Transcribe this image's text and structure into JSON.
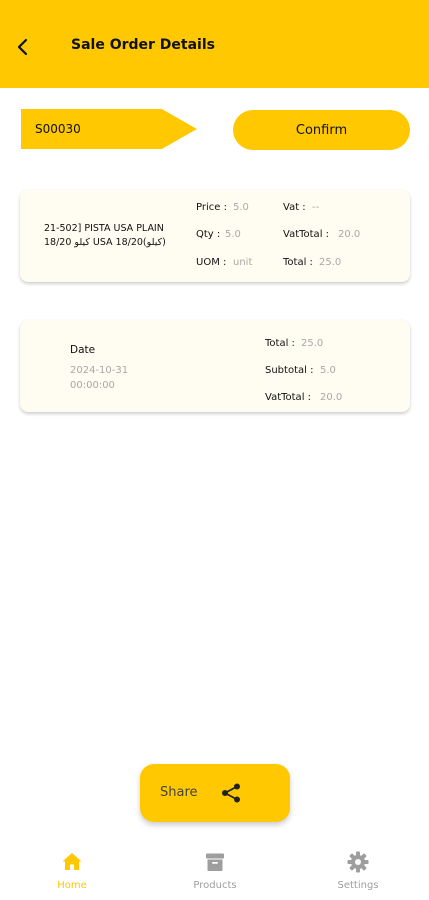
{
  "header": {
    "title": "Sale Order Details",
    "back_icon": "arrow-back-icon",
    "background": "#FFC800"
  },
  "order": {
    "number": "S00030",
    "confirm_label": "Confirm"
  },
  "product_card": {
    "name": "21-502] PISTA USA PLAIN 18/20 كيلو USA 18/20(كيلو)",
    "price_label": "Price :",
    "price_value": "5.0",
    "qty_label": "Qty :",
    "qty_value": "5.0",
    "uom_label": "UOM :",
    "uom_value": "unit",
    "vat_label": "Vat :",
    "vat_value": "--",
    "vattotal_label": "VatTotal :",
    "vattotal_value": "20.0",
    "total_label": "Total :",
    "total_value": "25.0"
  },
  "summary_card": {
    "date_label": "Date",
    "date_value": "2024-10-31",
    "time_value": "00:00:00",
    "total_label": "Total :",
    "total_value": "25.0",
    "subtotal_label": "Subtotal :",
    "subtotal_value": "5.0",
    "vattotal_label": "VatTotal :",
    "vattotal_value": "20.0"
  },
  "share": {
    "label": "Share",
    "icon": "share-icon"
  },
  "bottom_nav": {
    "items": [
      {
        "label": "Home",
        "icon": "home-icon",
        "active": true
      },
      {
        "label": "Products",
        "icon": "archive-box-icon",
        "active": false
      },
      {
        "label": "Settings",
        "icon": "gear-icon",
        "active": false
      }
    ],
    "active_color": "#FFC800",
    "inactive_color": "#9e9e9e"
  }
}
